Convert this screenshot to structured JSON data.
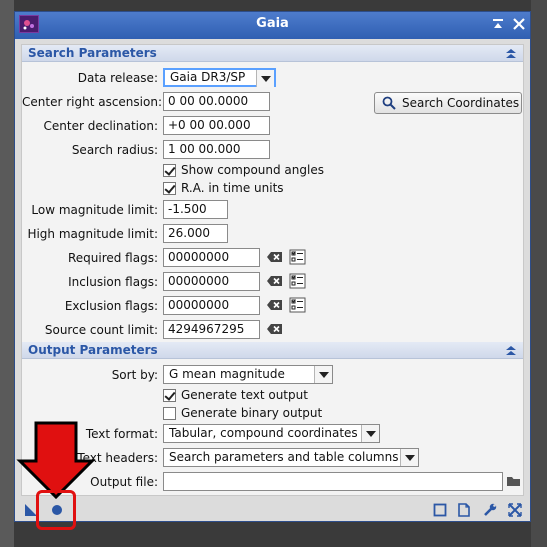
{
  "window": {
    "title": "Gaia"
  },
  "search": {
    "section_title": "Search Parameters",
    "data_release_label": "Data release:",
    "data_release_value": "Gaia DR3/SP",
    "ra_label": "Center right ascension:",
    "ra_value": "0 00 00.0000",
    "dec_label": "Center declination:",
    "dec_value": "+0 00 00.000",
    "radius_label": "Search radius:",
    "radius_value": "1 00 00.000",
    "search_coords_label": "Search Coordinates",
    "compound_label": "Show compound angles",
    "compound_checked": true,
    "ra_time_label": "R.A. in time units",
    "ra_time_checked": true,
    "low_mag_label": "Low magnitude limit:",
    "low_mag_value": "-1.500",
    "high_mag_label": "High magnitude limit:",
    "high_mag_value": "26.000",
    "required_label": "Required flags:",
    "required_value": "00000000",
    "inclusion_label": "Inclusion flags:",
    "inclusion_value": "00000000",
    "exclusion_label": "Exclusion flags:",
    "exclusion_value": "00000000",
    "source_count_label": "Source count limit:",
    "source_count_value": "4294967295"
  },
  "output": {
    "section_title": "Output Parameters",
    "sort_label": "Sort by:",
    "sort_value": "G mean magnitude",
    "gen_text_label": "Generate text output",
    "gen_text_checked": true,
    "gen_binary_label": "Generate binary output",
    "gen_binary_checked": false,
    "text_format_label": "Text format:",
    "text_format_value": "Tabular, compound coordinates",
    "text_headers_label": "Text headers:",
    "text_headers_value": "Search parameters and table columns",
    "output_file_label": "Output file:",
    "output_file_value": ""
  },
  "colors": {
    "accent": "#2b57a6",
    "annotation": "#e01010",
    "titlebar": "#3a6abf"
  }
}
